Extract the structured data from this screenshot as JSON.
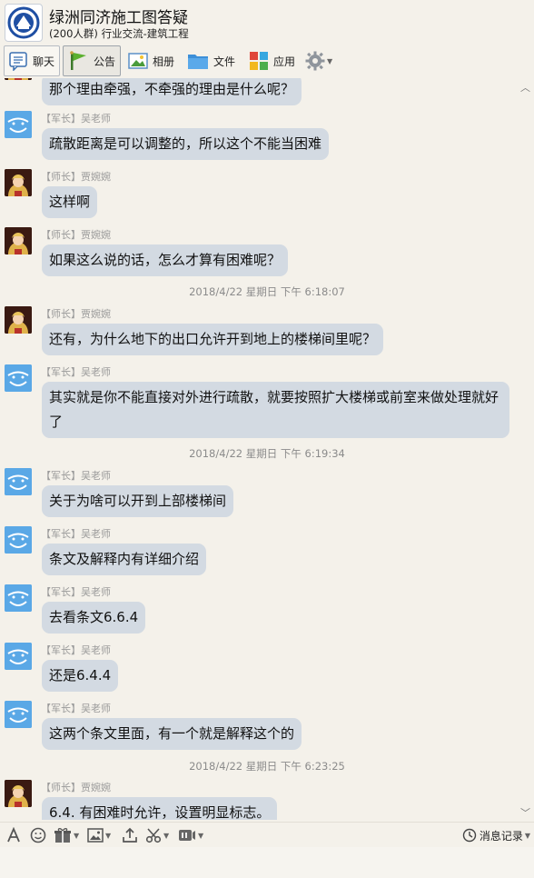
{
  "group": {
    "name": "绿洲同济施工图答疑",
    "subtitle": "(200人群) 行业交流-建筑工程"
  },
  "toolbar": {
    "tabs": [
      {
        "label": "聊天",
        "icon": "chat-icon"
      },
      {
        "label": "公告",
        "icon": "flag-icon"
      },
      {
        "label": "相册",
        "icon": "photo-icon"
      },
      {
        "label": "文件",
        "icon": "folder-icon"
      },
      {
        "label": "应用",
        "icon": "apps-icon"
      }
    ],
    "settings_icon": "gear-icon",
    "active_tab": "公告"
  },
  "messages": [
    {
      "type": "bubble",
      "text": "那个理由牵强，不牵强的理由是什么呢？"
    },
    {
      "type": "message",
      "role": "【军长】",
      "sender": "吴老师",
      "avatar": "blue",
      "text": "疏散距离是可以调整的，所以这个不能当困难"
    },
    {
      "type": "message",
      "role": "【师长】",
      "sender": "贾婉婉",
      "avatar": "dark",
      "text": "这样啊"
    },
    {
      "type": "message",
      "role": "【师长】",
      "sender": "贾婉婉",
      "avatar": "dark",
      "text": "如果这么说的话，怎么才算有困难呢？"
    },
    {
      "type": "timestamp",
      "text": "2018/4/22 星期日 下午 6:18:07"
    },
    {
      "type": "message",
      "role": "【师长】",
      "sender": "贾婉婉",
      "avatar": "dark",
      "text": "还有，为什么地下的出口允许开到地上的楼梯间里呢？"
    },
    {
      "type": "message",
      "role": "【军长】",
      "sender": "吴老师",
      "avatar": "blue",
      "text": "其实就是你不能直接对外进行疏散，就要按照扩大楼梯或前室来做处理就好了"
    },
    {
      "type": "timestamp",
      "text": "2018/4/22 星期日 下午 6:19:34"
    },
    {
      "type": "message",
      "role": "【军长】",
      "sender": "吴老师",
      "avatar": "blue",
      "text": "关于为啥可以开到上部楼梯间"
    },
    {
      "type": "message",
      "role": "【军长】",
      "sender": "吴老师",
      "avatar": "blue",
      "text": "条文及解释内有详细介绍"
    },
    {
      "type": "message",
      "role": "【军长】",
      "sender": "吴老师",
      "avatar": "blue",
      "text": "去看条文6.6.4"
    },
    {
      "type": "message",
      "role": "【军长】",
      "sender": "吴老师",
      "avatar": "blue",
      "text": "还是6.4.4"
    },
    {
      "type": "message",
      "role": "【军长】",
      "sender": "吴老师",
      "avatar": "blue",
      "text": "这两个条文里面，有一个就是解释这个的"
    },
    {
      "type": "timestamp",
      "text": "2018/4/22 星期日 下午 6:23:25"
    },
    {
      "type": "message",
      "role": "【师长】",
      "sender": "贾婉婉",
      "avatar": "dark",
      "text": "6.4. 有困难时允许，设置明显标志。"
    }
  ],
  "input_toolbar": {
    "tools": [
      "font-icon",
      "emoji-icon",
      "gift-icon",
      "image-icon",
      "upload-icon",
      "screenshot-icon",
      "voice-icon"
    ],
    "history_label": "消息记录"
  },
  "colors": {
    "background": "#f4f1ea",
    "bubble": "#d3dae2",
    "sender": "#9a9a9a",
    "timestamp": "#8b8b8b"
  }
}
